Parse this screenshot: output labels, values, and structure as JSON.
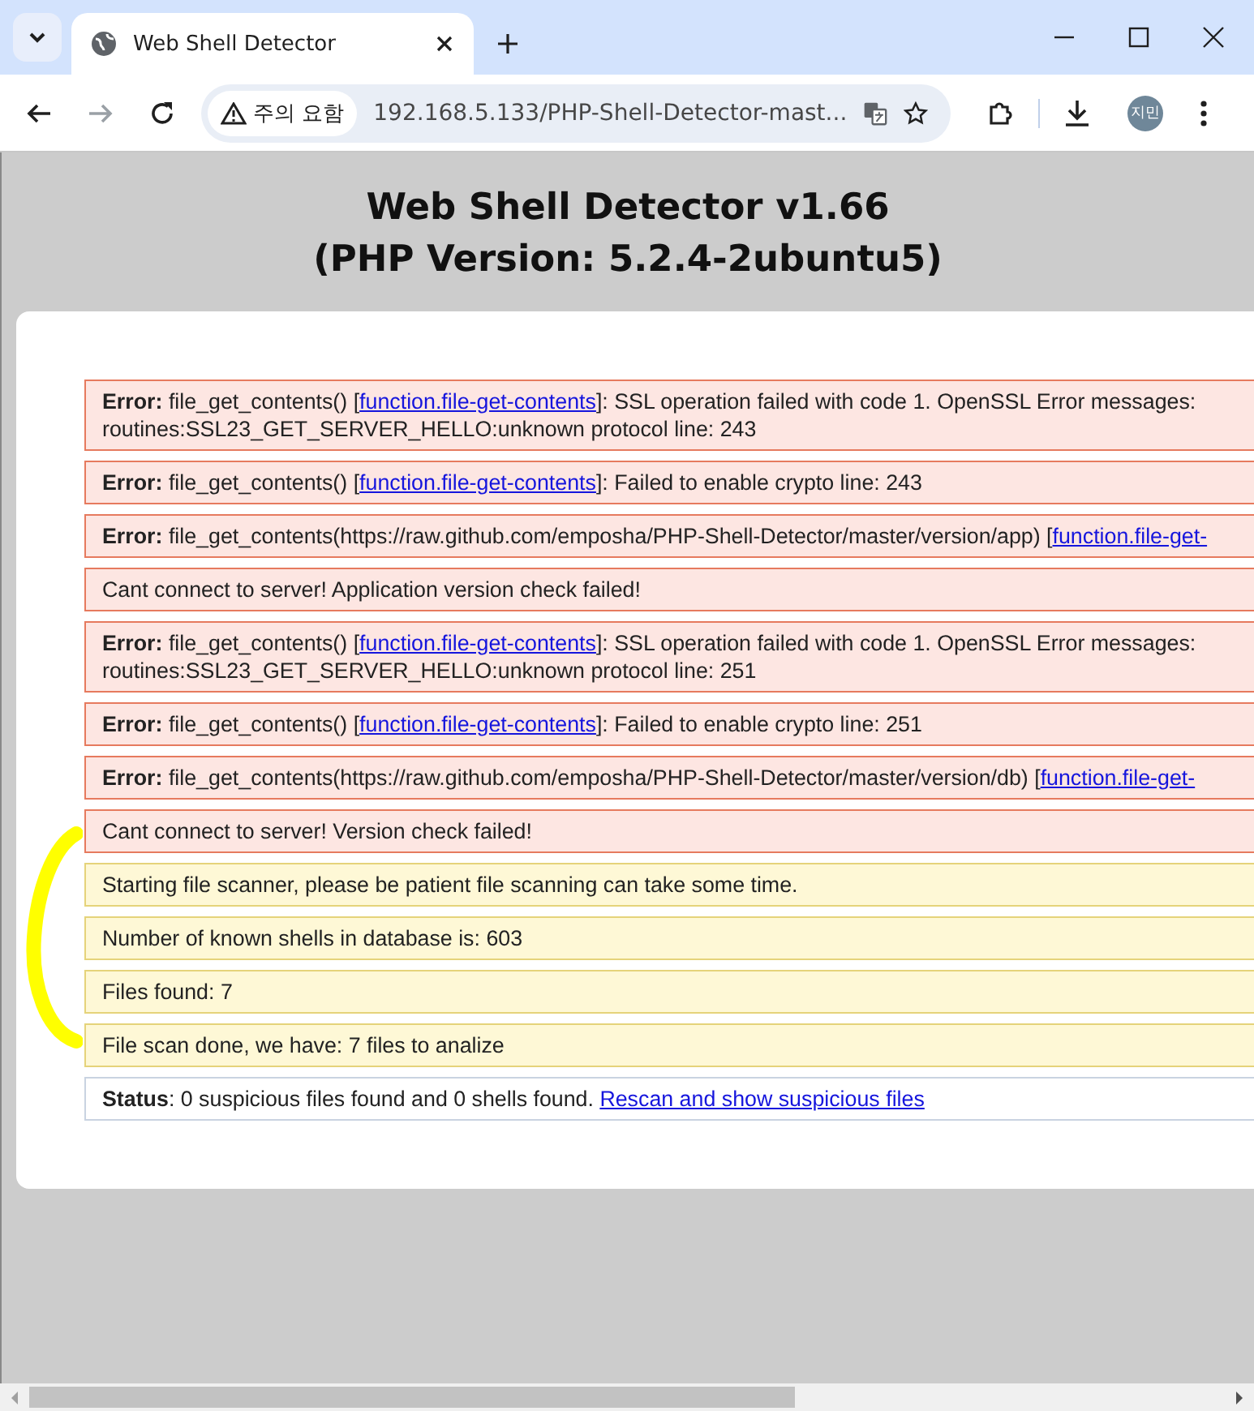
{
  "browser": {
    "tab_title": "Web Shell Detector",
    "security_chip": "주의 요함",
    "url": "192.168.5.133/PHP-Shell-Detector-mast...",
    "profile_initials": "지민"
  },
  "page": {
    "title_line_1": "Web Shell Detector v1.66",
    "title_line_2": "(PHP Version: 5.2.4-2ubuntu5)"
  },
  "messages": [
    {
      "kind": "error",
      "label": "Error:",
      "text": " file_get_contents() [",
      "link": "function.file-get-contents",
      "after": "]: SSL operation failed with code 1. OpenSSL Error messages:",
      "line_2": "routines:SSL23_GET_SERVER_HELLO:unknown protocol line: 243"
    },
    {
      "kind": "error",
      "label": "Error:",
      "text": " file_get_contents() [",
      "link": "function.file-get-contents",
      "after": "]: Failed to enable crypto line: 243"
    },
    {
      "kind": "error",
      "label": "Error:",
      "text": " file_get_contents(https://raw.github.com/emposha/PHP-Shell-Detector/master/version/app) [",
      "link": "function.file-get-"
    },
    {
      "kind": "error",
      "text": "Cant connect to server! Application version check failed!"
    },
    {
      "kind": "error",
      "label": "Error:",
      "text": " file_get_contents() [",
      "link": "function.file-get-contents",
      "after": "]: SSL operation failed with code 1. OpenSSL Error messages:",
      "line_2": "routines:SSL23_GET_SERVER_HELLO:unknown protocol line: 251"
    },
    {
      "kind": "error",
      "label": "Error:",
      "text": " file_get_contents() [",
      "link": "function.file-get-contents",
      "after": "]: Failed to enable crypto line: 251"
    },
    {
      "kind": "error",
      "label": "Error:",
      "text": " file_get_contents(https://raw.github.com/emposha/PHP-Shell-Detector/master/version/db) [",
      "link": "function.file-get-"
    },
    {
      "kind": "error",
      "text": "Cant connect to server! Version check failed!"
    },
    {
      "kind": "notice",
      "text": "Starting file scanner, please be patient file scanning can take some time."
    },
    {
      "kind": "notice",
      "text": "Number of known shells in database is: 603"
    },
    {
      "kind": "notice",
      "text": "Files found: 7"
    },
    {
      "kind": "notice",
      "text": "File scan done, we have: 7 files to analize"
    },
    {
      "kind": "status",
      "label": "Status",
      "text": ": 0 suspicious files found and 0 shells found. ",
      "link": "Rescan and show suspicious files"
    }
  ]
}
